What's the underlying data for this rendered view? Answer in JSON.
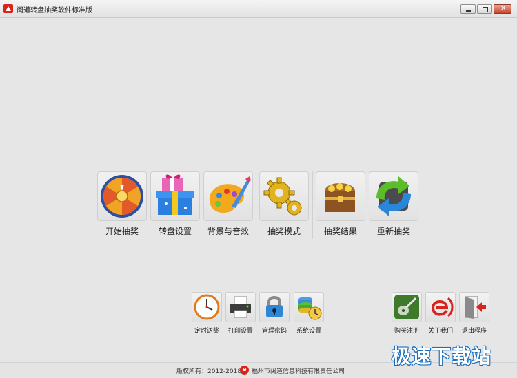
{
  "window": {
    "title": "闽道转盘抽奖软件标准版",
    "controls": {
      "minimize": "minimize-icon",
      "maximize": "maximize-icon",
      "close": "close-icon"
    }
  },
  "main_actions": [
    {
      "label": "开始抽奖",
      "icon": "prize-wheel-icon"
    },
    {
      "label": "转盘设置",
      "icon": "gift-box-icon"
    },
    {
      "label": "背景与音效",
      "icon": "paint-palette-icon"
    },
    {
      "label": "抽奖模式",
      "icon": "gears-icon"
    },
    {
      "label": "抽奖结果",
      "icon": "treasure-chest-icon"
    },
    {
      "label": "重新抽奖",
      "icon": "refresh-arrows-icon"
    }
  ],
  "tools": [
    {
      "label": "定时送奖",
      "icon": "clock-icon"
    },
    {
      "label": "打印设置",
      "icon": "printer-icon"
    },
    {
      "label": "管理密码",
      "icon": "padlock-icon"
    },
    {
      "label": "系统设置",
      "icon": "database-clock-icon"
    }
  ],
  "system_actions": [
    {
      "label": "购买注册",
      "icon": "guitar-icon"
    },
    {
      "label": "关于我们",
      "icon": "e-logo-icon"
    },
    {
      "label": "退出程序",
      "icon": "exit-door-icon"
    }
  ],
  "footer": {
    "copyright": "版权所有：2012-2018",
    "company": "福州市闽道信息科技有限责任公司"
  },
  "watermark": "极速下载站",
  "colors": {
    "background": "#e6e6e6",
    "accent_red": "#d8241d",
    "watermark_blue": "#1a6fbf"
  }
}
